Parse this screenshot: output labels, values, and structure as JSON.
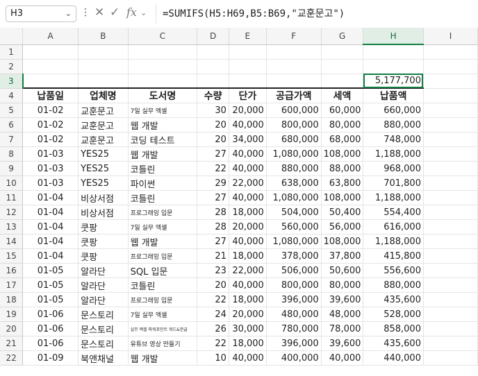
{
  "name_box": {
    "value": "H3"
  },
  "formula": {
    "value": "=SUMIFS(H5:H69,B5:B69,\"교훈문고\")"
  },
  "columns": [
    "A",
    "B",
    "C",
    "D",
    "E",
    "F",
    "G",
    "H",
    "I"
  ],
  "row_numbers": [
    "1",
    "2",
    "3",
    "4",
    "5",
    "6",
    "7",
    "8",
    "9",
    "10",
    "11",
    "12",
    "13",
    "14",
    "15",
    "16",
    "17",
    "18",
    "19",
    "20",
    "21",
    "22"
  ],
  "cells": {
    "h3": "5,177,700"
  },
  "headers": [
    "납품일",
    "업체명",
    "도서명",
    "수량",
    "단가",
    "공급가액",
    "세액",
    "납품액"
  ],
  "rows": [
    [
      "01-02",
      "교훈문고",
      "7일 실무 엑셀",
      "30",
      "20,000",
      "600,000",
      "60,000",
      "660,000"
    ],
    [
      "01-02",
      "교훈문고",
      "웹 개발",
      "20",
      "40,000",
      "800,000",
      "80,000",
      "880,000"
    ],
    [
      "01-02",
      "교훈문고",
      "코딩 테스트",
      "20",
      "34,000",
      "680,000",
      "68,000",
      "748,000"
    ],
    [
      "01-03",
      "YES25",
      "웹 개발",
      "27",
      "40,000",
      "1,080,000",
      "108,000",
      "1,188,000"
    ],
    [
      "01-03",
      "YES25",
      "코틀린",
      "22",
      "40,000",
      "880,000",
      "88,000",
      "968,000"
    ],
    [
      "01-03",
      "YES25",
      "파이썬",
      "29",
      "22,000",
      "638,000",
      "63,800",
      "701,800"
    ],
    [
      "01-04",
      "비상서점",
      "코틀린",
      "27",
      "40,000",
      "1,080,000",
      "108,000",
      "1,188,000"
    ],
    [
      "01-04",
      "비상서점",
      "프로그래밍 입문",
      "28",
      "18,000",
      "504,000",
      "50,400",
      "554,400"
    ],
    [
      "01-04",
      "쿳팡",
      "7일 실무 엑셀",
      "28",
      "20,000",
      "560,000",
      "56,000",
      "616,000"
    ],
    [
      "01-04",
      "쿳팡",
      "웹 개발",
      "27",
      "40,000",
      "1,080,000",
      "108,000",
      "1,188,000"
    ],
    [
      "01-04",
      "쿳팡",
      "프로그래밍 입문",
      "21",
      "18,000",
      "378,000",
      "37,800",
      "415,800"
    ],
    [
      "01-05",
      "알라단",
      "SQL 입문",
      "23",
      "22,000",
      "506,000",
      "50,600",
      "556,600"
    ],
    [
      "01-05",
      "알라단",
      "코틀린",
      "20",
      "40,000",
      "800,000",
      "80,000",
      "880,000"
    ],
    [
      "01-05",
      "알라단",
      "프로그래밍 입문",
      "22",
      "18,000",
      "396,000",
      "39,600",
      "435,600"
    ],
    [
      "01-06",
      "문스토리",
      "7일 실무 엑셀",
      "24",
      "20,000",
      "480,000",
      "48,000",
      "528,000"
    ],
    [
      "01-06",
      "문스토리",
      "실무 엑셀 파워포인트 워드&한글",
      "26",
      "30,000",
      "780,000",
      "78,000",
      "858,000"
    ],
    [
      "01-06",
      "문스토리",
      "유튜브 영상 만들기",
      "22",
      "18,000",
      "396,000",
      "39,600",
      "435,600"
    ],
    [
      "01-09",
      "북앤채널",
      "웹 개발",
      "10",
      "40,000",
      "400,000",
      "40,000",
      "440,000"
    ]
  ]
}
